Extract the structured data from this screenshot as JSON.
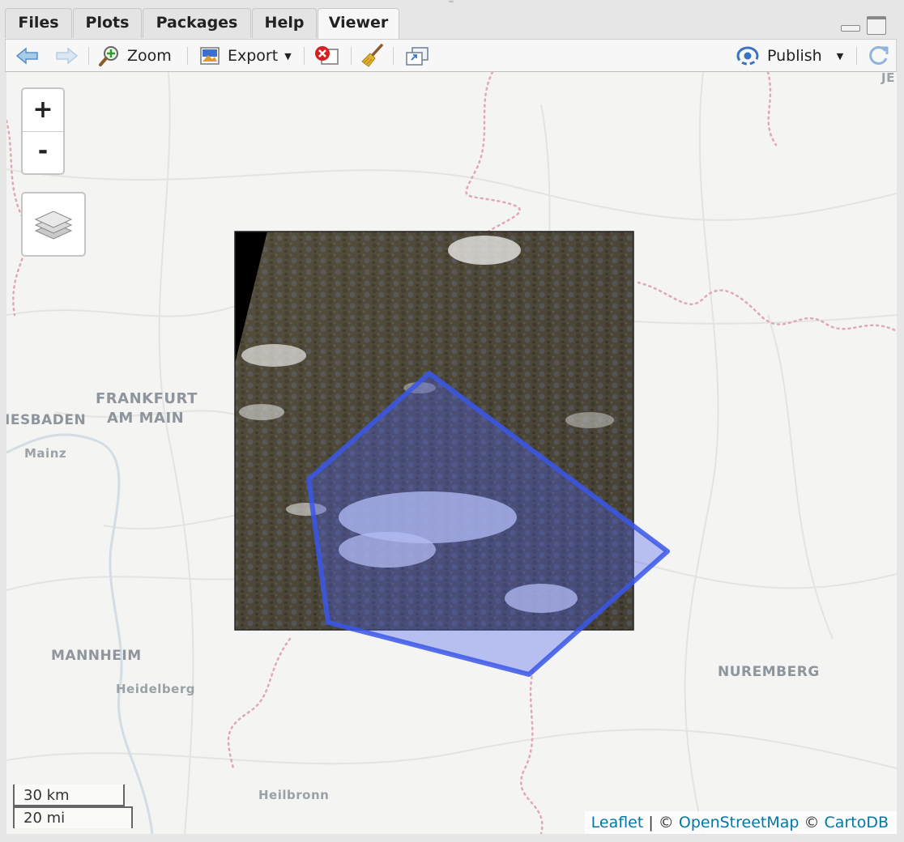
{
  "tabs": [
    {
      "label": "Files"
    },
    {
      "label": "Plots"
    },
    {
      "label": "Packages"
    },
    {
      "label": "Help"
    },
    {
      "label": "Viewer",
      "active": true
    }
  ],
  "toolbar": {
    "back_icon": "arrow-left-icon",
    "forward_icon": "arrow-right-icon",
    "zoom_label": "Zoom",
    "export_label": "Export",
    "clear_icon": "remove-plot-icon",
    "broom_icon": "broom-icon",
    "popout_icon": "show-in-window-icon",
    "publish_label": "Publish",
    "refresh_icon": "refresh-icon"
  },
  "map": {
    "zoom_in": "+",
    "zoom_out": "-",
    "layers_icon": "layers-icon",
    "places": {
      "frankfurt_1": "FRANKFURT",
      "frankfurt_2": "AM MAIN",
      "wiesbaden": "IESBADEN",
      "mainz": "Mainz",
      "mannheim": "MANNHEIM",
      "heidelberg": "Heidelberg",
      "nuremberg": "NUREMBERG",
      "heilbronn": "Heilbronn",
      "jena_fragment": "JE"
    },
    "scale_km": "30 km",
    "scale_mi": "20 mi",
    "attribution": {
      "leaflet": "Leaflet",
      "sep": " | © ",
      "osm": "OpenStreetMap",
      "sep2": " © ",
      "carto": "CartoDB"
    },
    "colors": {
      "polygon_stroke": "#3a57e8",
      "polygon_fill": "#4a62ee",
      "border_dotted": "#e0a8b4",
      "link": "#0078a8"
    }
  }
}
